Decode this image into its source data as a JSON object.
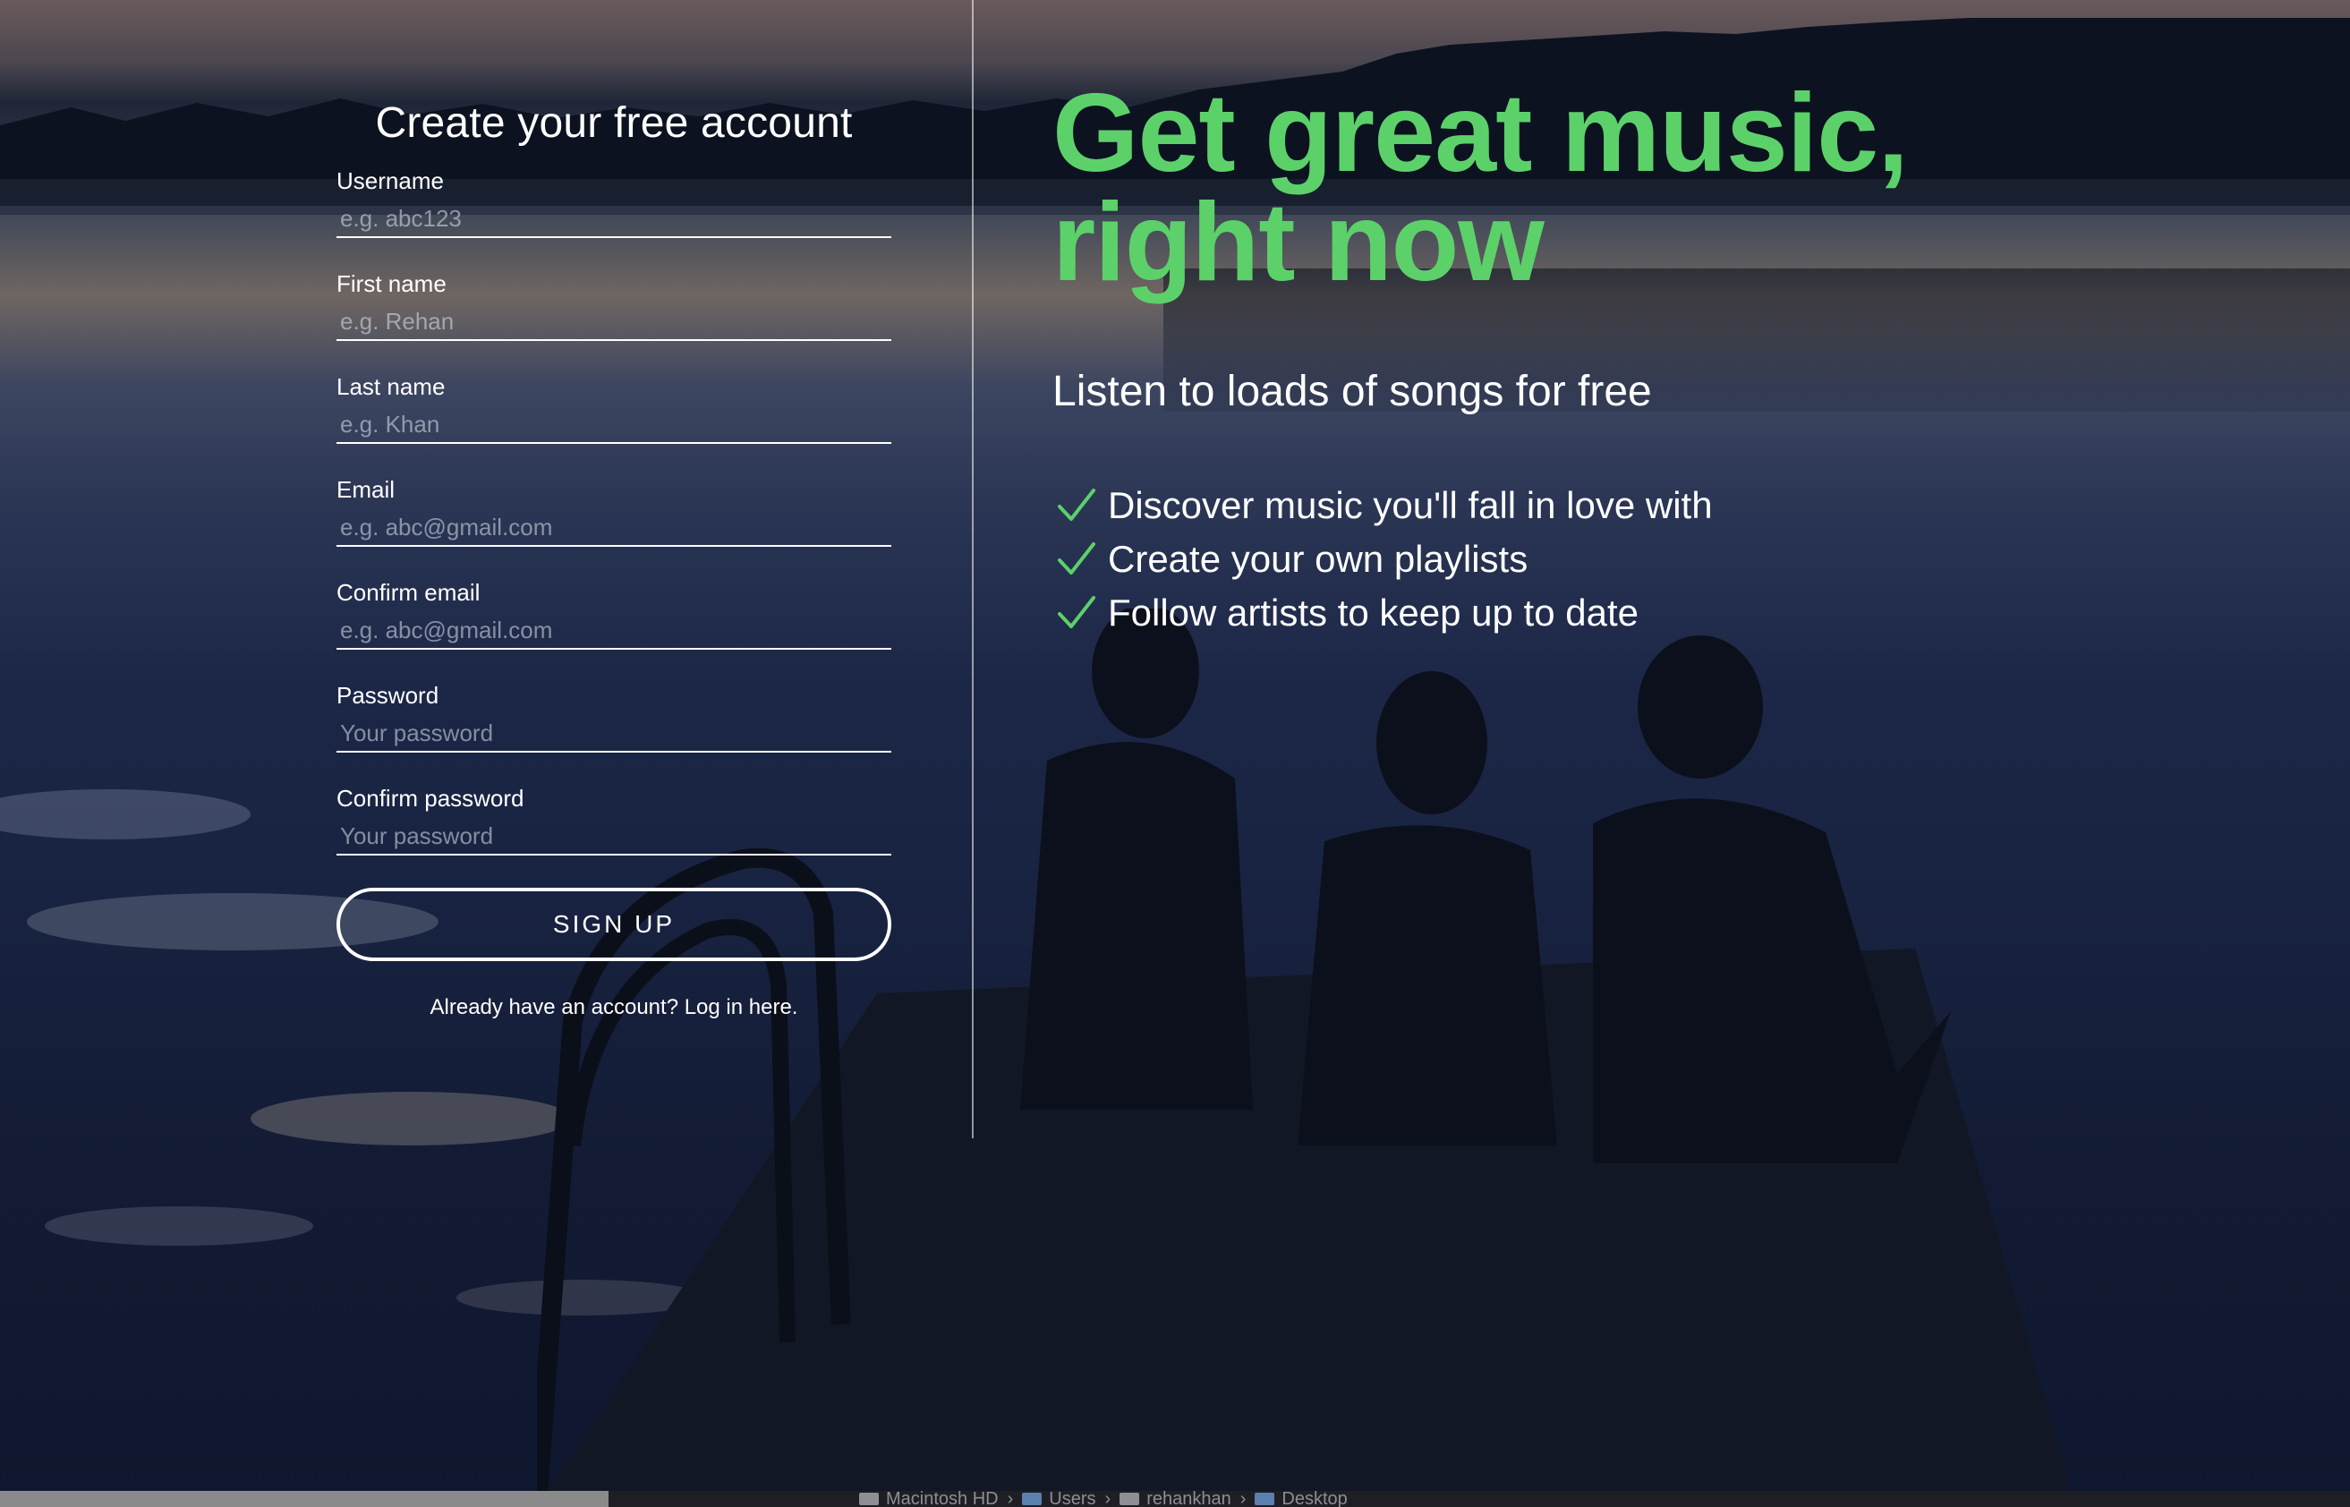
{
  "signup_form": {
    "title": "Create your free account",
    "fields": [
      {
        "id": "username",
        "label": "Username",
        "placeholder": "e.g. abc123",
        "type": "text"
      },
      {
        "id": "first_name",
        "label": "First name",
        "placeholder": "e.g. Rehan",
        "type": "text"
      },
      {
        "id": "last_name",
        "label": "Last name",
        "placeholder": "e.g. Khan",
        "type": "text"
      },
      {
        "id": "email",
        "label": "Email",
        "placeholder": "e.g. abc@gmail.com",
        "type": "email"
      },
      {
        "id": "confirm_email",
        "label": "Confirm email",
        "placeholder": "e.g. abc@gmail.com",
        "type": "email"
      },
      {
        "id": "password",
        "label": "Password",
        "placeholder": "Your password",
        "type": "password"
      },
      {
        "id": "confirm_password",
        "label": "Confirm password",
        "placeholder": "Your password",
        "type": "password"
      }
    ],
    "submit_label": "SIGN UP",
    "login_prompt": "Already have an account? Log in here."
  },
  "hero": {
    "title_line1": "Get great music,",
    "title_line2": "right now",
    "subtitle": "Listen to loads of songs for free",
    "features": [
      "Discover music you'll fall in love with",
      "Create your own playlists",
      "Follow artists to keep up to date"
    ],
    "feature_icon": "check-icon",
    "accent_color": "#5cd16a"
  },
  "finder_path": {
    "crumbs": [
      "Macintosh HD",
      "Users",
      "rehankhan",
      "Desktop"
    ]
  }
}
